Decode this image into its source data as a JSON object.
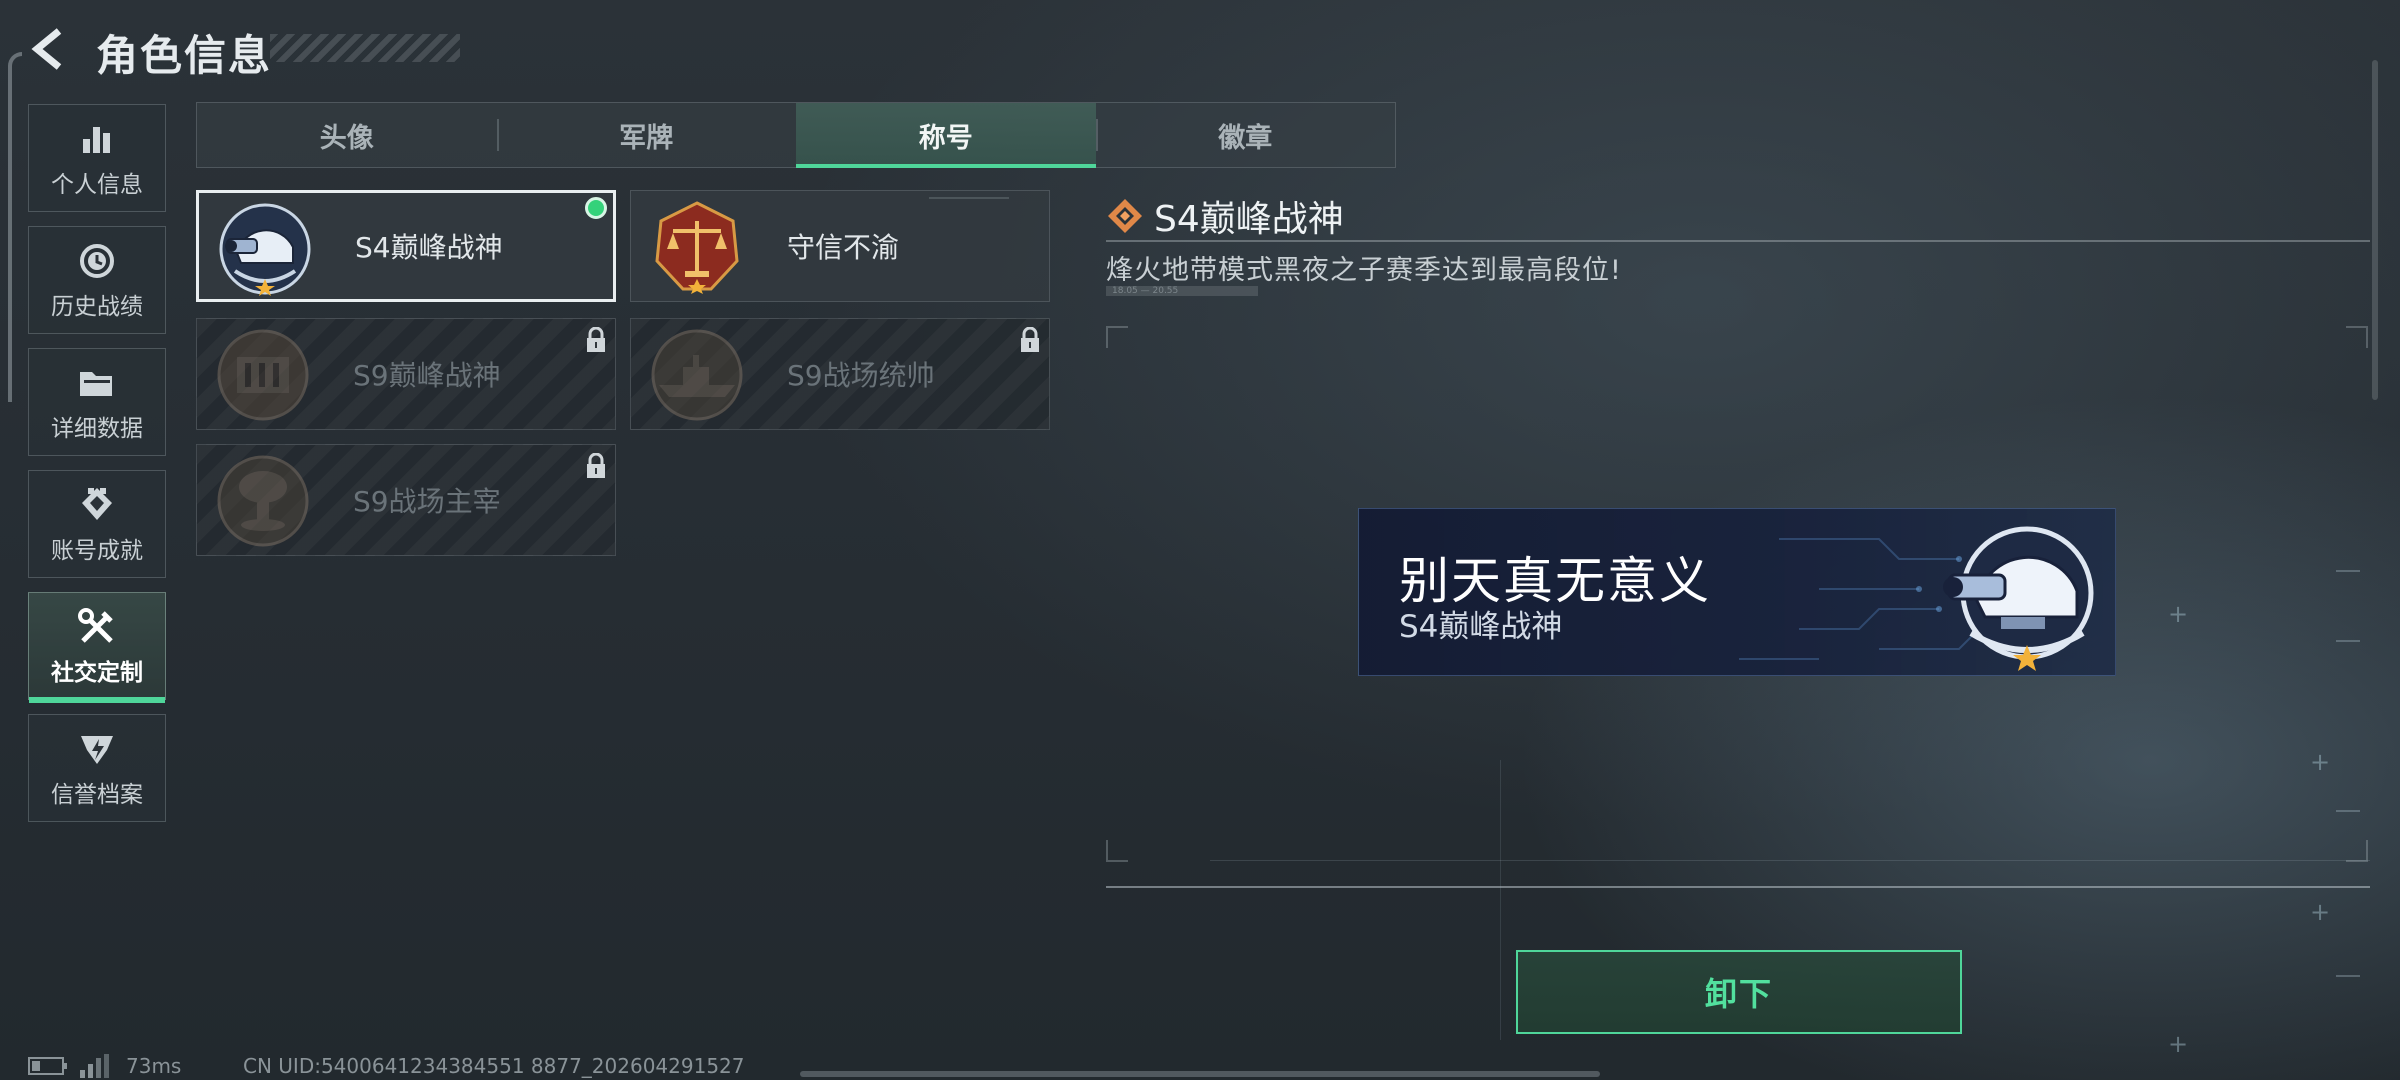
{
  "header": {
    "title": "角色信息"
  },
  "sidebar": {
    "items": [
      {
        "label": "个人信息",
        "icon": "bar-chart-icon"
      },
      {
        "label": "历史战绩",
        "icon": "history-clock-icon"
      },
      {
        "label": "详细数据",
        "icon": "folder-icon"
      },
      {
        "label": "账号成就",
        "icon": "achievement-icon"
      },
      {
        "label": "社交定制",
        "icon": "tools-icon",
        "active": true
      },
      {
        "label": "信誉档案",
        "icon": "credit-shield-icon"
      }
    ]
  },
  "tabs": [
    {
      "label": "头像"
    },
    {
      "label": "军牌"
    },
    {
      "label": "称号",
      "active": true
    },
    {
      "label": "徽章"
    }
  ],
  "titles": [
    {
      "name": "S4巅峰战神",
      "state": "equipped",
      "emblem": "night-vision-helmet-emblem"
    },
    {
      "name": "守信不渝",
      "state": "owned",
      "emblem": "scales-emblem"
    },
    {
      "name": "S9巅峰战神",
      "state": "locked",
      "emblem": "fortress-emblem"
    },
    {
      "name": "S9战场统帅",
      "state": "locked",
      "emblem": "warship-emblem"
    },
    {
      "name": "S9战场主宰",
      "state": "locked",
      "emblem": "mushroom-cloud-emblem"
    }
  ],
  "detail": {
    "title": "S4巅峰战神",
    "description": "烽火地带模式黑夜之子赛季达到最高段位!",
    "date_hint": "18.05 — 20.55"
  },
  "banner": {
    "player_name": "别天真无意义",
    "title": "S4巅峰战神"
  },
  "actions": {
    "unequip_label": "卸下"
  },
  "footer": {
    "ping": "73ms",
    "uid": "CN UID:5400641234384551 8877_202604291527"
  },
  "colors": {
    "accent": "#4fd69a",
    "equipped_dot": "#34d27a",
    "background": "#262d33"
  }
}
